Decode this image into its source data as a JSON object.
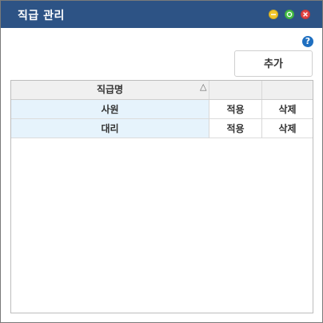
{
  "window": {
    "title": "직급 관리",
    "help_label": "?",
    "add_label": "추가"
  },
  "colors": {
    "titlebar": "#2d5385",
    "minimize": "#f1c62a",
    "maximize": "#48c44a",
    "close": "#e34242",
    "help": "#1f6fc0",
    "row_highlight": "#e6f3fc"
  },
  "table": {
    "columns": [
      "직급명",
      "",
      ""
    ],
    "sort_indicator": "△",
    "rows": [
      {
        "name": "사원",
        "apply": "적용",
        "delete": "삭제"
      },
      {
        "name": "대리",
        "apply": "적용",
        "delete": "삭제"
      }
    ]
  }
}
